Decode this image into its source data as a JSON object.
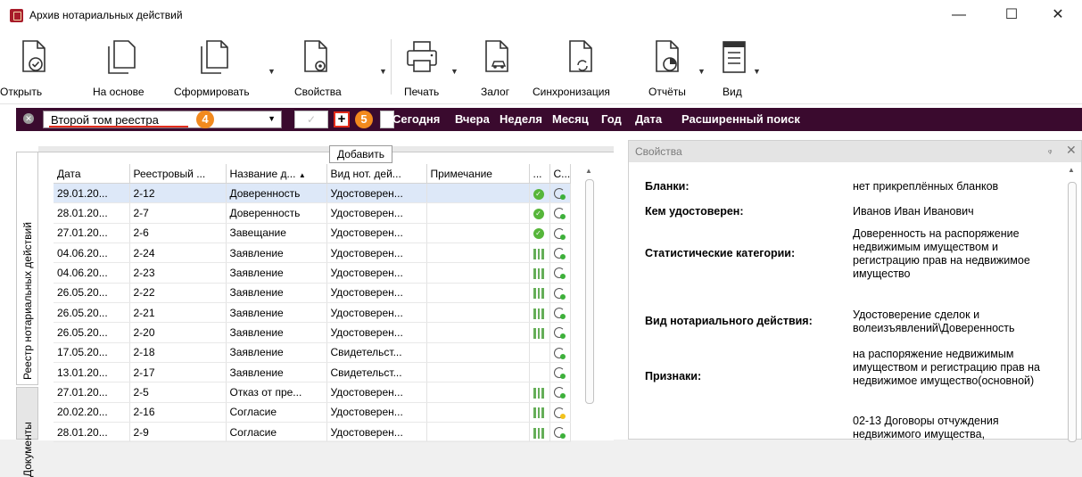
{
  "window": {
    "title": "Архив нотариальных действий",
    "controls": {
      "minimize": "—",
      "maximize": "☐",
      "close": "✕"
    }
  },
  "ribbon": {
    "buttons": [
      {
        "label": "Открыть",
        "icon": "open-doc-icon",
        "hotkey": "О"
      },
      {
        "label": "На основе",
        "icon": "copy-doc-icon",
        "hotkey": "Н"
      },
      {
        "label": "Сформировать",
        "icon": "new-doc-icon",
        "hotkey": "С"
      },
      {
        "label": "Свойства",
        "icon": "properties-doc-icon",
        "hotkey": "С"
      },
      {
        "label": "Печать",
        "icon": "printer-icon",
        "hotkey": "П"
      },
      {
        "label": "Залог",
        "icon": "car-pledge-icon",
        "hotkey": "З"
      },
      {
        "label": "Синхронизация",
        "icon": "sync-doc-icon",
        "hotkey": "С"
      },
      {
        "label": "Отчёты",
        "icon": "reports-icon",
        "hotkey": "О"
      },
      {
        "label": "Вид",
        "icon": "view-icon",
        "hotkey": "В"
      }
    ]
  },
  "filterbar": {
    "selected": "Второй том реестра",
    "badge_1": "4",
    "badge_2": "5",
    "check_mark": "✓",
    "add_symbol": "+",
    "quick_filters": [
      "Сегодня",
      "Вчера",
      "Неделя",
      "Месяц",
      "Год",
      "Дата",
      "Расширенный поиск"
    ]
  },
  "tooltip": "Добавить",
  "side_tabs": {
    "registry": "Реестр нотариальных действий",
    "documents": "Документы"
  },
  "grid": {
    "columns": [
      "Дата",
      "Реестровый ...",
      "Название д...",
      "Вид нот. дей...",
      "Примечание",
      "...",
      "С..."
    ],
    "sort_indicator": "▲",
    "rows": [
      {
        "date": "29.01.20...",
        "reg": "2-12",
        "name": "Доверенность",
        "kind": "Удостоверен...",
        "note": "",
        "status": "ok",
        "sync": "green"
      },
      {
        "date": "28.01.20...",
        "reg": "2-7",
        "name": "Доверенность",
        "kind": "Удостоверен...",
        "note": "",
        "status": "ok",
        "sync": "green"
      },
      {
        "date": "27.01.20...",
        "reg": "2-6",
        "name": "Завещание",
        "kind": "Удостоверен...",
        "note": "",
        "status": "ok",
        "sync": "green"
      },
      {
        "date": "04.06.20...",
        "reg": "2-24",
        "name": "Заявление",
        "kind": "Удостоверен...",
        "note": "",
        "status": "qr",
        "sync": "green"
      },
      {
        "date": "04.06.20...",
        "reg": "2-23",
        "name": "Заявление",
        "kind": "Удостоверен...",
        "note": "",
        "status": "qr",
        "sync": "green"
      },
      {
        "date": "26.05.20...",
        "reg": "2-22",
        "name": "Заявление",
        "kind": "Удостоверен...",
        "note": "",
        "status": "qr",
        "sync": "green"
      },
      {
        "date": "26.05.20...",
        "reg": "2-21",
        "name": "Заявление",
        "kind": "Удостоверен...",
        "note": "",
        "status": "qr",
        "sync": "green"
      },
      {
        "date": "26.05.20...",
        "reg": "2-20",
        "name": "Заявление",
        "kind": "Удостоверен...",
        "note": "",
        "status": "qr",
        "sync": "green"
      },
      {
        "date": "17.05.20...",
        "reg": "2-18",
        "name": "Заявление",
        "kind": "Свидетельст...",
        "note": "",
        "status": "",
        "sync": "green"
      },
      {
        "date": "13.01.20...",
        "reg": "2-17",
        "name": "Заявление",
        "kind": "Свидетельст...",
        "note": "",
        "status": "",
        "sync": "green"
      },
      {
        "date": "27.01.20...",
        "reg": "2-5",
        "name": "Отказ от пре...",
        "kind": "Удостоверен...",
        "note": "",
        "status": "qr",
        "sync": "green"
      },
      {
        "date": "20.02.20...",
        "reg": "2-16",
        "name": "Согласие",
        "kind": "Удостоверен...",
        "note": "",
        "status": "qr",
        "sync": "yellow"
      },
      {
        "date": "28.01.20...",
        "reg": "2-9",
        "name": "Согласие",
        "kind": "Удостоверен...",
        "note": "",
        "status": "qr",
        "sync": "green"
      }
    ]
  },
  "properties": {
    "title": "Свойства",
    "pin": "ᵩ",
    "close": "✕",
    "items": [
      {
        "key": "Бланки:",
        "value": "нет прикреплённых бланков"
      },
      {
        "key": "Кем удостоверен:",
        "value": "Иванов Иван Иванович"
      },
      {
        "key": "Статистические категории:",
        "value": "Доверенность на распоряжение недвижимым имуществом и регистрацию прав на недвижимое имущество"
      },
      {
        "key": "Вид нотариального действия:",
        "value": "Удостоверение сделок и волеизъявлений\\Доверенность"
      },
      {
        "key": "Признаки:",
        "value": "на распоряжение недвижимым имуществом и регистрацию прав на недвижимое имущество(основной)"
      },
      {
        "key": "",
        "value": "02-13 Договоры отчуждения недвижимого имущества,"
      }
    ]
  }
}
